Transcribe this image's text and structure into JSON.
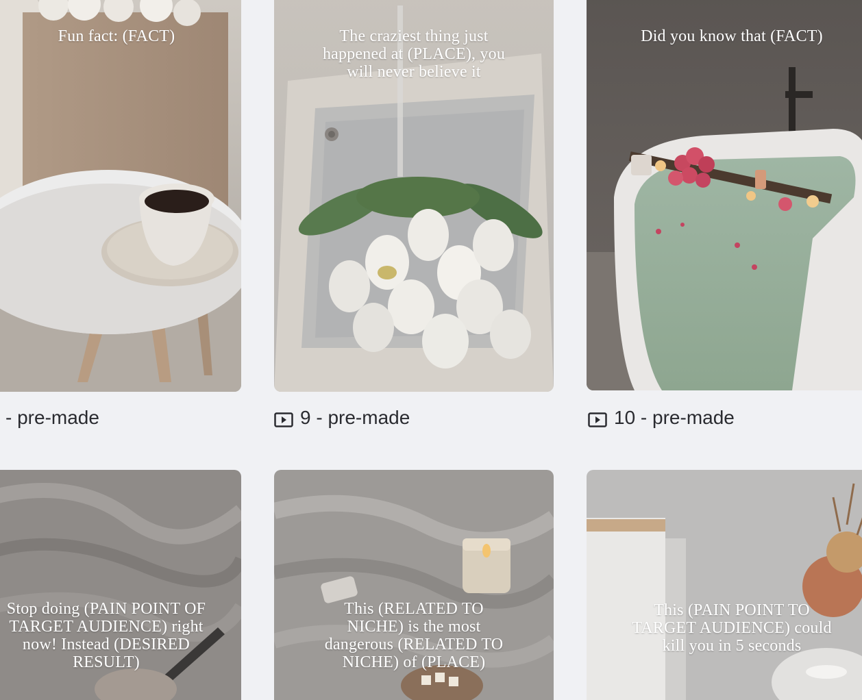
{
  "templates": [
    {
      "overlay": "Fun fact: (FACT)",
      "caption": "- pre-made",
      "show_icon": false
    },
    {
      "overlay": "The craziest thing just happened at (PLACE), you will never believe it",
      "caption": "9 - pre-made",
      "show_icon": true
    },
    {
      "overlay": "Did you know that (FACT)",
      "caption": "10 - pre-made",
      "show_icon": true
    },
    {
      "overlay": "Stop doing (PAIN POINT OF TARGET AUDIENCE) right now! Instead (DESIRED RESULT)"
    },
    {
      "overlay": "This (RELATED TO NICHE) is the most dangerous (RELATED TO NICHE) of (PLACE)"
    },
    {
      "overlay": "This (PAIN POINT TO TARGET AUDIENCE) could kill you in 5 seconds"
    }
  ],
  "icons": {
    "caption_icon": "video-icon"
  },
  "colors": {
    "page_background": "#f0f1f4",
    "caption_text": "#2a2b30",
    "overlay_text": "#ffffff"
  }
}
